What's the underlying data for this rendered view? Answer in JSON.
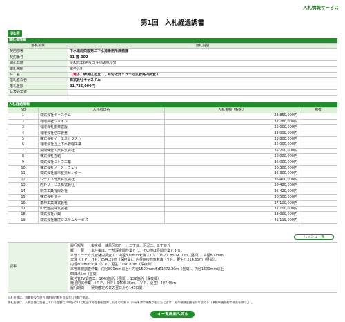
{
  "header": {
    "service_label": "入札情報サービス",
    "title": "第1回　入札経過調書",
    "round_tab": "第1回"
  },
  "bid_info": {
    "section_title": "落札者情報",
    "col_item": "落札項目",
    "col_content": "落札内容",
    "rows": [
      {
        "label": "契約部署",
        "value": "下水道局西部第二下水道事務所庶務課"
      },
      {
        "label": "契約番号",
        "value": "31-鶴-002"
      },
      {
        "label": "開札日時",
        "value": "令和元年6月6日 午前9時00分"
      },
      {
        "label": "開札場所",
        "value": "電子入札"
      },
      {
        "label": "件　名",
        "kind": "【電子】",
        "value": "練馬区旭丘二丁目付近外ミラー方式管路内調査工"
      },
      {
        "label": "落札者氏名",
        "value": "株式会社キャステム"
      },
      {
        "label": "落札金額",
        "value": "31,735,000円"
      },
      {
        "label": "公表通知書",
        "value": ""
      }
    ]
  },
  "bids": {
    "section_title": "入札経過情報",
    "col_no": "No",
    "col_name": "入札者氏名",
    "col_amount": "入札金額（税抜）",
    "col_remarks": "備考",
    "rows": [
      {
        "no": "1",
        "name": "株式会社キャステム",
        "amount": "28,850,000円"
      },
      {
        "no": "2",
        "name": "有限会社シャイン",
        "amount": "32,780,000円"
      },
      {
        "no": "3",
        "name": "有限会社南栄建設",
        "amount": "33,000,000円"
      },
      {
        "no": "4",
        "name": "有限会社信栄管整",
        "amount": "33,000,000円"
      },
      {
        "no": "5",
        "name": "株式会社イーエストラスト",
        "amount": "33,800,000円"
      },
      {
        "no": "6",
        "name": "有限会社丘上下水管理工業",
        "amount": "35,000,000円"
      },
      {
        "no": "7",
        "name": "清関保全工業株式会社",
        "amount": "35,700,000円"
      },
      {
        "no": "8",
        "name": "株式会社吉結",
        "amount": "36,000,000円"
      },
      {
        "no": "9",
        "name": "株式会社コトウ工業",
        "amount": "36,000,000円"
      },
      {
        "no": "10",
        "name": "株式会社ノース・ウェイ",
        "amount": "36,300,000円"
      },
      {
        "no": "11",
        "name": "株式会社都市整美センター",
        "amount": "36,300,000円"
      },
      {
        "no": "12",
        "name": "ジーエス管業株式会社",
        "amount": "36,400,000円"
      },
      {
        "no": "13",
        "name": "内外サービス株式会社",
        "amount": "36,420,000円"
      },
      {
        "no": "14",
        "name": "新栄工業有限会社",
        "amount": "36,420,000円"
      },
      {
        "no": "15",
        "name": "株式会社マキ",
        "amount": "36,500,000円"
      },
      {
        "no": "16",
        "name": "泰伸工業株式会社",
        "amount": "37,100,000円"
      },
      {
        "no": "17",
        "name": "山代建設株式会社",
        "amount": "37,100,000円"
      },
      {
        "no": "18",
        "name": "株式会社八興",
        "amount": "38,000,000円"
      },
      {
        "no": "19",
        "name": "株式会社環境システムサービス",
        "amount": "41,119,000円"
      }
    ],
    "list_button": "ハッシュ一覧"
  },
  "notes": {
    "label": "記事",
    "lines": [
      "履行場所　　東京都　練馬区旭丘一、二丁目、羽沢二、三丁目外",
      "概　　要　　本件策は、一部深夜間作業とし、その他は昼間作業とする。",
      "本管ミラー方式管路内調査工：内径800mm未満（ＴＶ、ＨＰ）8509.10ｍ（昼間）、内径800mm",
      "未満（ＴＰ、ＨＰ）894.25ｍ（深夜間）、内径800mm未満（ＶＰ、更生）216.65ｍ（昼間）、",
      "内径800mm未満（ＶＰ、更生）190.80ｍ（深夜間）",
      "本管目視調査作業：内径800mm以上～内径1500mm未満1472.20ｍ（昼間）、内径1500mm以上",
      "653.05ｍ（昼間）",
      "取付管TV調査工：1640箇所（昼間）：132箇所（深夜間）",
      "簡易閉化作業：（ＴＰ、ＨＰ）9403.35ｍ、（ＶＰ、更生）407.45ｍ",
      "履行期間　　契約確定の日の翌日から145日間"
    ]
  },
  "footnotes": [
    "入札金額は、消費税及び地方消費税の額を含まない金額である。",
    "落札金額は、入札金額に記載している金額に100分の10に相当する金額を加算したものである（1円未満の端数が生じたときは、その端数金額を切り捨てる（単数単価契約の場合を除く。））。"
  ],
  "footer": {
    "back_button": "◀ 一覧画面へ戻る"
  },
  "colors": {
    "accent": "#1f8f2a",
    "header_cell": "#dff0d8",
    "label_cell": "#e8f4e4",
    "kind_red": "#d6001c"
  }
}
